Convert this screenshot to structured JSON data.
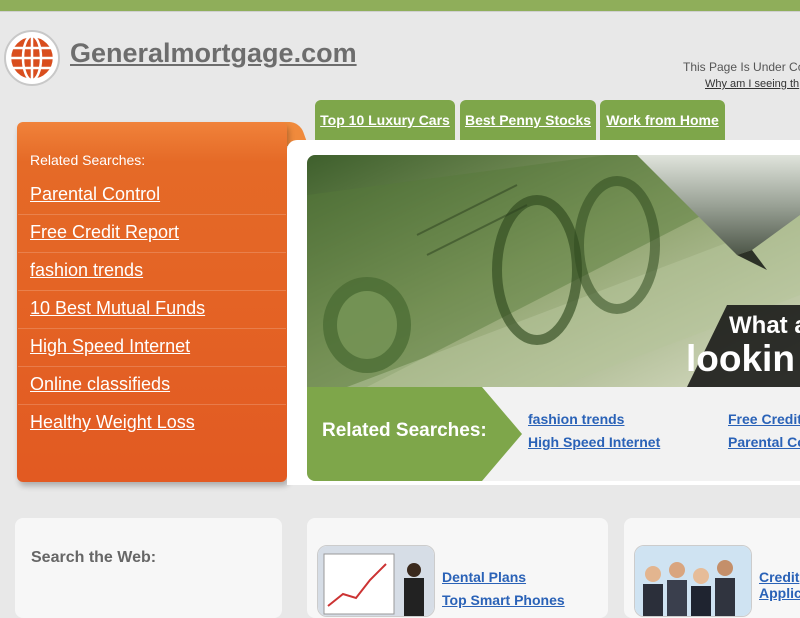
{
  "header": {
    "site_name": "Generalmortgage.com",
    "under_construction": "This Page Is Under Co",
    "why_link": "Why am I seeing th"
  },
  "tabs": [
    {
      "label": "Top 10 Luxury Cars"
    },
    {
      "label": "Best Penny Stocks"
    },
    {
      "label": "Work from Home"
    }
  ],
  "sidebar": {
    "title": "Related Searches:",
    "items": [
      {
        "label": "Parental Control"
      },
      {
        "label": "Free Credit Report"
      },
      {
        "label": "fashion trends"
      },
      {
        "label": "10 Best Mutual Funds"
      },
      {
        "label": "High Speed Internet"
      },
      {
        "label": "Online classifieds"
      },
      {
        "label": "Healthy Weight Loss"
      }
    ]
  },
  "hero": {
    "headline_line1": "What a",
    "headline_line2": "lookin"
  },
  "related_bar": {
    "label": "Related Searches:",
    "links": [
      "fashion trends",
      "High Speed Internet",
      "Free Credit",
      "Parental Co"
    ]
  },
  "bottom": {
    "search_label": "Search the Web:",
    "box2_links": [
      "Dental Plans",
      "Top Smart Phones"
    ],
    "box3_links": [
      "Credit",
      "Applic"
    ]
  },
  "colors": {
    "accent_green": "#8fae5a",
    "tab_green": "#7ea64a",
    "panel_orange": "#e25a22",
    "link_blue": "#2a62b7"
  },
  "icons": {
    "logo": "globe-icon"
  }
}
